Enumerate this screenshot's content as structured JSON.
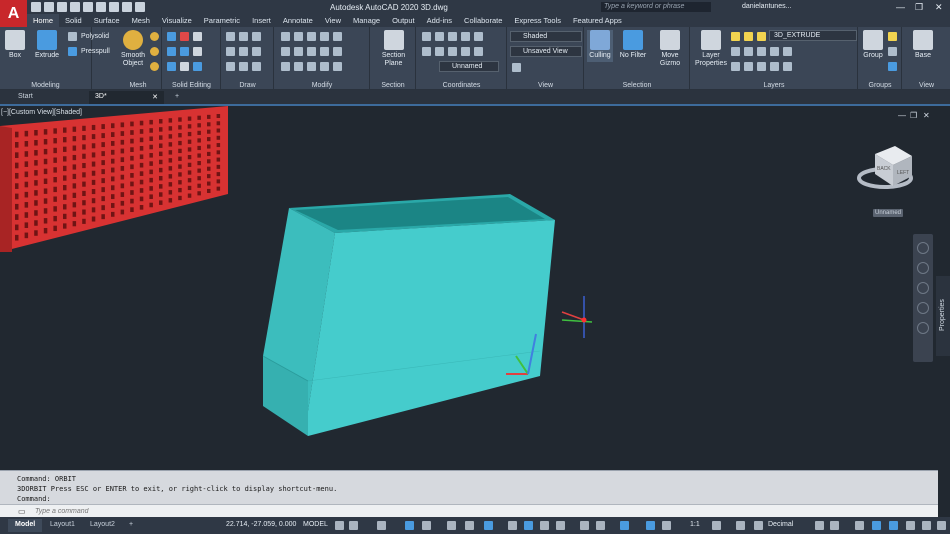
{
  "app": {
    "logo": "A",
    "window_title": "Autodesk AutoCAD 2020    3D.dwg",
    "search_placeholder": "Type a keyword or phrase",
    "user": "danielantunes...",
    "minimize": "—",
    "restore": "❐",
    "close": "✕"
  },
  "ribbon_tabs": [
    "Home",
    "Solid",
    "Surface",
    "Mesh",
    "Visualize",
    "Parametric",
    "Insert",
    "Annotate",
    "View",
    "Manage",
    "Output",
    "Add-ins",
    "Collaborate",
    "Express Tools",
    "Featured Apps"
  ],
  "ribbon": {
    "modeling": {
      "label": "Modeling",
      "box": "Box",
      "extrude": "Extrude",
      "polysolid": "Polysolid",
      "presspull": "Presspull"
    },
    "mesh": {
      "label": "Mesh",
      "smooth_object_1": "Smooth",
      "smooth_object_2": "Object"
    },
    "solid_editing": {
      "label": "Solid Editing"
    },
    "draw": {
      "label": "Draw"
    },
    "modify": {
      "label": "Modify"
    },
    "section": {
      "label": "Section",
      "plane_1": "Section",
      "plane_2": "Plane"
    },
    "coordinates": {
      "label": "Coordinates",
      "ucs_value": "Unnamed"
    },
    "view": {
      "label": "View",
      "visual_style": "Shaded",
      "saved_view": "Unsaved View"
    },
    "selection": {
      "label": "Selection",
      "culling": "Culling",
      "no_filter": "No Filter",
      "move_gizmo_1": "Move",
      "move_gizmo_2": "Gizmo"
    },
    "layers": {
      "label": "Layers",
      "layer_properties_1": "Layer",
      "layer_properties_2": "Properties",
      "current_layer": "3D_EXTRUDE",
      "layer_color": "#e02020"
    },
    "groups": {
      "label": "Groups",
      "group": "Group"
    },
    "view2": {
      "label": "View",
      "base": "Base"
    }
  },
  "doc_tabs": [
    "Start",
    "3D*"
  ],
  "doc_tab_close": "✕",
  "doc_tab_add": "+",
  "viewport": {
    "label": "[−][Custom View][Shaded]",
    "viewcube_top": "BACK",
    "viewcube_side": "LEFT",
    "viewcube_label": "Unnamed",
    "properties_label": "Properties",
    "solid_color": "#45cccc",
    "wall_color": "#e03c3c"
  },
  "command": {
    "line1": "Command: ORBIT",
    "line2": "3DORBIT Press ESC or ENTER to exit, or right-click to display shortcut-menu.",
    "line3": "Command:",
    "placeholder": "Type a command"
  },
  "status": {
    "tabs": [
      "Model",
      "Layout1",
      "Layout2"
    ],
    "add": "+",
    "coords": "22.714, -27.059, 0.000",
    "model": "MODEL",
    "scale": "1:1",
    "units": "Decimal"
  }
}
